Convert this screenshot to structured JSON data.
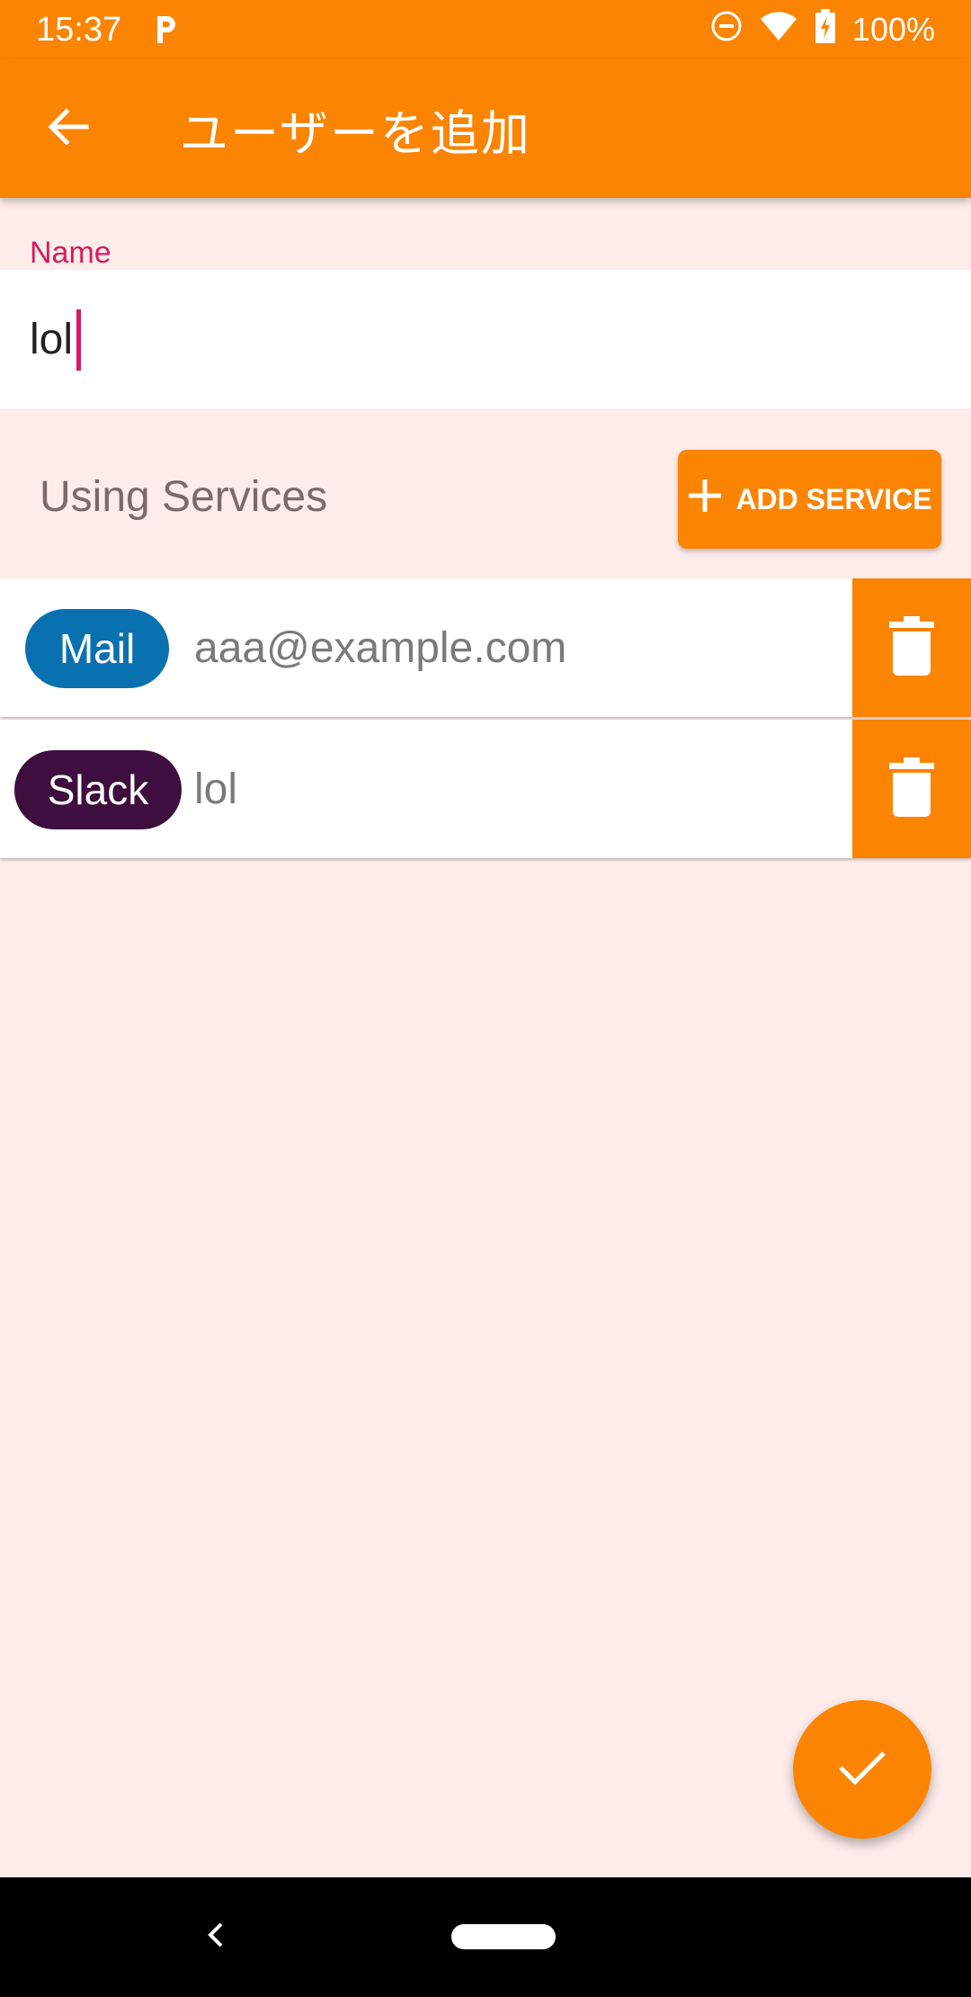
{
  "status_bar": {
    "time": "15:37",
    "battery_text": "100%",
    "icons": [
      "parking-icon",
      "dnd-icon",
      "wifi-icon",
      "battery-charging-icon"
    ]
  },
  "app_bar": {
    "title": "ユーザーを追加",
    "back_icon": "arrow-back-icon"
  },
  "name_field": {
    "label": "Name",
    "value": "lol"
  },
  "services": {
    "title": "Using Services",
    "add_label": "ADD SERVICE",
    "items": [
      {
        "service": "Mail",
        "value": "aaa@example.com",
        "color": "#0a71b0"
      },
      {
        "service": "Slack",
        "value": "lol",
        "color": "#3e0e3f"
      }
    ]
  },
  "colors": {
    "accent": "#fb8402",
    "background": "#fdecea",
    "field_label": "#d81b60"
  },
  "fab": {
    "icon": "check-icon"
  }
}
